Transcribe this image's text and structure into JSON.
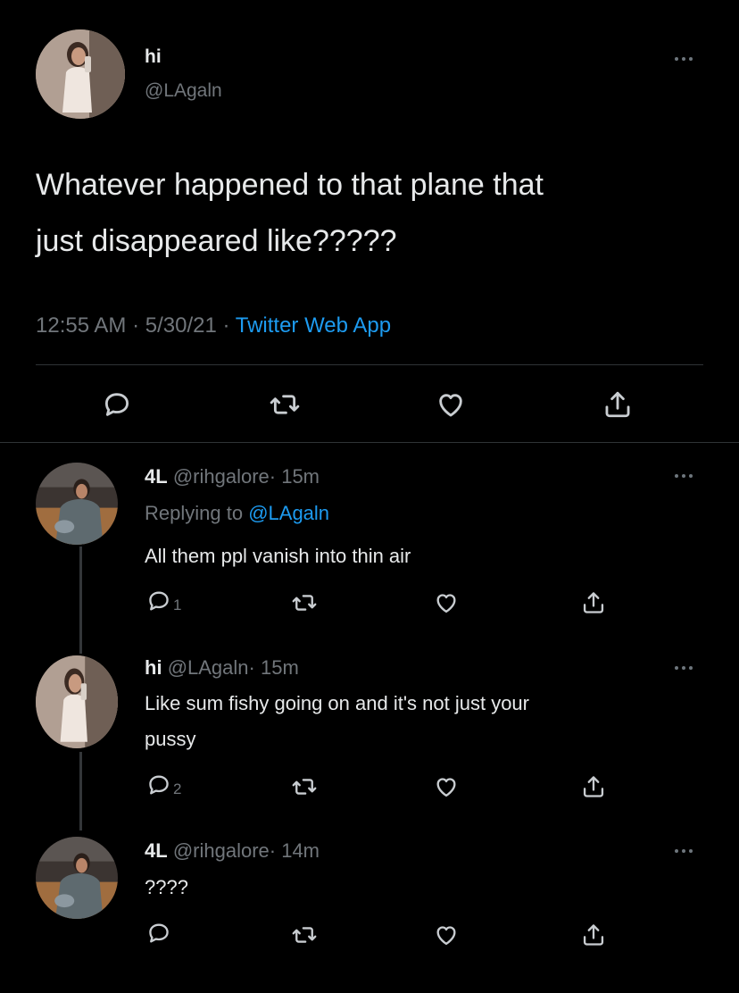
{
  "main_tweet": {
    "display_name": "hi",
    "handle": "@LAgaln",
    "text_line1": "Whatever happened to that plane that",
    "text_line2": "just disappeared like?????",
    "time": "12:55 AM",
    "sep1": "·",
    "date": "5/30/21",
    "sep2": "·",
    "source": "Twitter Web App"
  },
  "replies": [
    {
      "display_name": "4L",
      "handle": "@rihgalore",
      "sep": "·",
      "age": "15m",
      "replying_prefix": "Replying to",
      "replying_handle": "@LAgaln",
      "text": "All them ppl vanish into thin air",
      "reply_count": "1"
    },
    {
      "display_name": "hi",
      "handle": "@LAgaln",
      "sep": "·",
      "age": "15m",
      "text_line1": "Like sum fishy going on and it's not just your",
      "text_line2": "pussy",
      "reply_count": "2"
    },
    {
      "display_name": "4L",
      "handle": "@rihgalore",
      "sep": "·",
      "age": "14m",
      "text": "????"
    }
  ],
  "icons": {
    "reply": "reply-icon",
    "retweet": "retweet-icon",
    "like": "like-icon",
    "share": "share-icon",
    "more": "more-icon"
  },
  "colors": {
    "background": "#000000",
    "text": "#e7e9ea",
    "muted": "#71767b",
    "link": "#1d9bf0",
    "divider": "#2f3336"
  }
}
